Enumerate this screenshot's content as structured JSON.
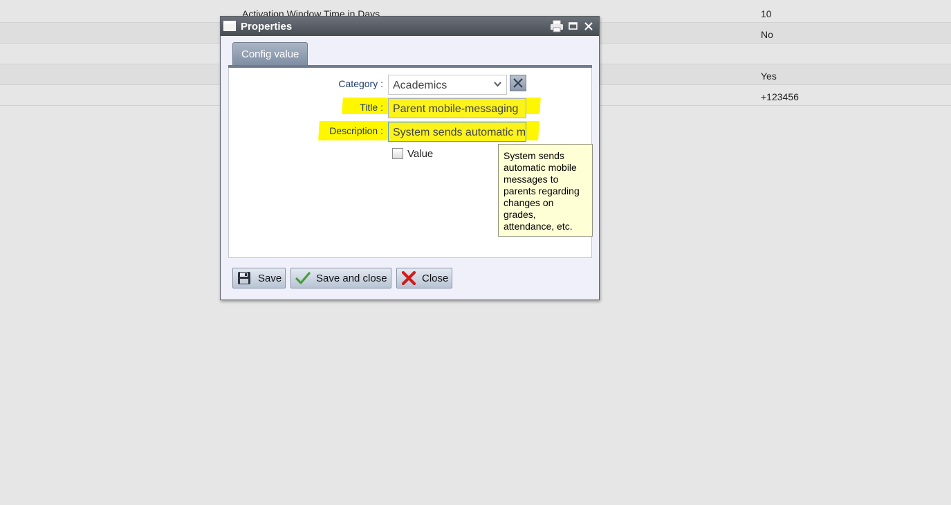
{
  "background_table": {
    "rows": [
      {
        "name": "Activation Window Time in Days",
        "value": "10"
      },
      {
        "name": "",
        "value": "No"
      },
      {
        "name": "",
        "value": ""
      },
      {
        "name": "",
        "value": "Yes"
      },
      {
        "name": "",
        "value": "+123456"
      }
    ]
  },
  "dialog": {
    "title": "Properties",
    "tab_label": "Config value",
    "form": {
      "category_label": "Category :",
      "category_value": "Academics",
      "title_label": "Title :",
      "title_value": "Parent mobile-messaging",
      "description_label": "Description :",
      "description_value": "System sends automatic mobile messages to parents regarding changes on grades, attendance, etc.",
      "value_label": "Value",
      "value_checked": false
    },
    "tooltip_text": "System sends automatic mobile messages to parents regarding changes on grades, attendance, etc.",
    "buttons": {
      "save": "Save",
      "save_and_close": "Save and close",
      "close": "Close"
    }
  },
  "colors": {
    "highlight": "#fff700",
    "titlebar": "#474c53",
    "tab": "#8d9bb0",
    "tooltip_bg": "#ffffd6"
  }
}
